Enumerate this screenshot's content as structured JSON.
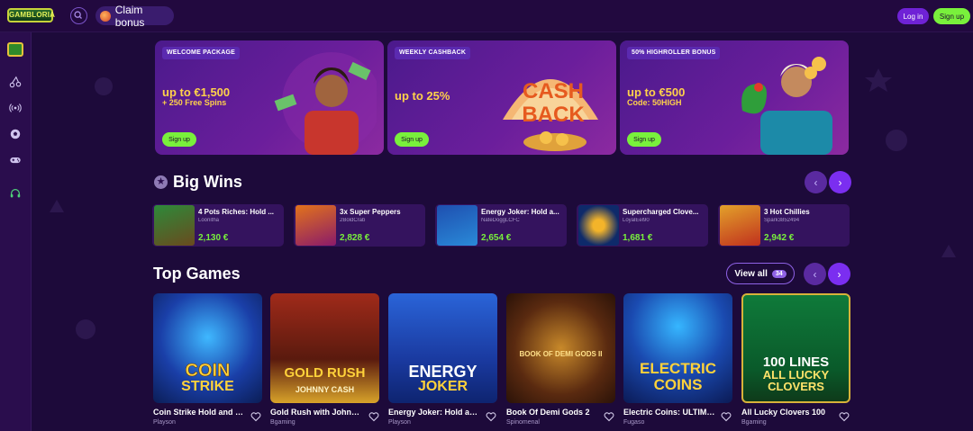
{
  "topbar": {
    "logo_text": "GAMBLORIA",
    "claim_label": "Claim bonus",
    "login_label": "Log in",
    "signup_label": "Sign up"
  },
  "sidebar": {
    "items": [
      {
        "icon": "slot-machine-icon"
      },
      {
        "icon": "cherries-icon"
      },
      {
        "icon": "live-broadcast-icon"
      },
      {
        "icon": "soccer-ball-icon"
      },
      {
        "icon": "gamepad-icon"
      },
      {
        "icon": "headset-icon"
      }
    ]
  },
  "banners": [
    {
      "tag": "WELCOME PACKAGE",
      "headline": "up to €1,500",
      "subline": "+ 250 Free Spins",
      "button": "Sign up"
    },
    {
      "tag": "WEEKLY CASHBACK",
      "headline": "up to 25%",
      "subline": "",
      "button": "Sign up",
      "art_text_1": "CASH",
      "art_text_2": "BACK"
    },
    {
      "tag": "50% HIGHROLLER BONUS",
      "headline": "up to €500",
      "subline": "Code: 50HIGH",
      "button": "Sign up"
    }
  ],
  "big_wins": {
    "title": "Big Wins",
    "items": [
      {
        "game": "4 Pots Riches: Hold ...",
        "user": "Loonitha",
        "amount": "2,130 €"
      },
      {
        "game": "3x Super Peppers",
        "user": "2BoldCrab",
        "amount": "2,828 €"
      },
      {
        "game": "Energy Joker: Hold a...",
        "user": "NateDoggLCFC",
        "amount": "2,654 €"
      },
      {
        "game": "Supercharged Clove...",
        "user": "LoyalEel90",
        "amount": "1,681 €"
      },
      {
        "game": "3 Hot Chillies",
        "user": "Spark3852494",
        "amount": "2,942 €"
      }
    ]
  },
  "top_games": {
    "title": "Top Games",
    "view_all": "View all",
    "count": "34",
    "items": [
      {
        "name": "Coin Strike Hold and Win",
        "provider": "Playson",
        "art_line_1": "COIN",
        "art_line_2": "STRIKE"
      },
      {
        "name": "Gold Rush with Johnny ...",
        "provider": "Bgaming",
        "art_line_1": "GOLD RUSH",
        "art_line_2": "JOHNNY CASH"
      },
      {
        "name": "Energy Joker: Hold and ...",
        "provider": "Playson",
        "art_line_1": "ENERGY",
        "art_line_2": "JOKER"
      },
      {
        "name": "Book Of Demi Gods 2",
        "provider": "Spinomenal",
        "art_line_1": "BOOK OF DEMI GODS II",
        "art_line_2": ""
      },
      {
        "name": "Electric Coins: ULTIMATE...",
        "provider": "Fugaso",
        "art_line_1": "ELECTRIC",
        "art_line_2": "COINS"
      },
      {
        "name": "All Lucky Clovers 100",
        "provider": "Bgaming",
        "art_line_1": "100 LINES",
        "art_line_2": "ALL LUCKY CLOVERS"
      }
    ]
  },
  "colors": {
    "background": "#1d0a3a",
    "accent_green": "#79f03c",
    "accent_purple": "#7b2ef0"
  }
}
